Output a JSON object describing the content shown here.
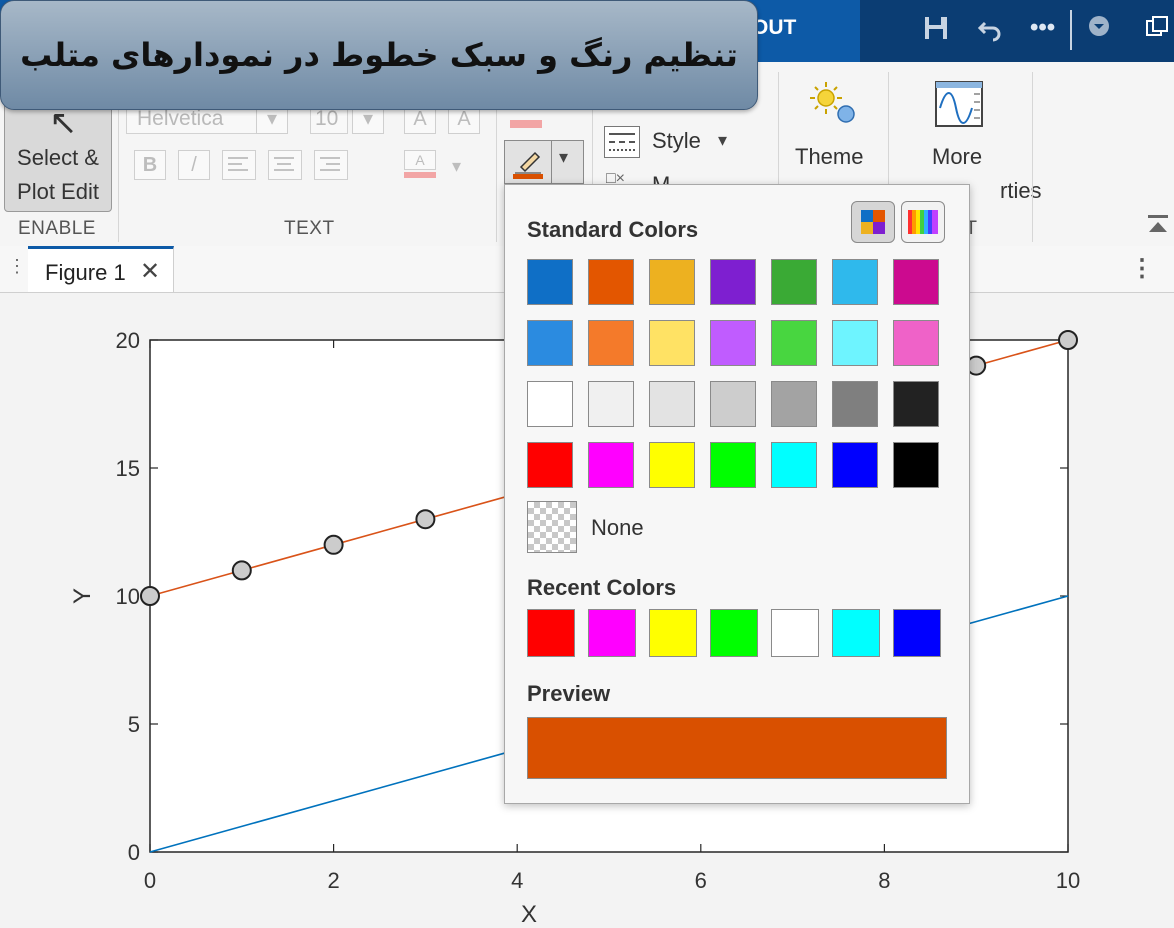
{
  "banner": {
    "title": "تنظیم رنگ و سبک خطوط در نمودارهای متلب"
  },
  "toolstrip": {
    "active_tab": "OUT",
    "icons": [
      "save-icon",
      "undo-icon",
      "more-icon",
      "dropdown-icon",
      "undock-icon"
    ]
  },
  "ribbon": {
    "select_label_1": "Select &",
    "select_label_2": "Plot Edit",
    "group_enable": "ENABLE",
    "group_text": "TEXT",
    "group_object_partial": "ECT",
    "font_name": "Helvetica",
    "font_size": "10",
    "font_grow": "A",
    "font_shrink": "A",
    "bold": "B",
    "italic": "/",
    "color_a": "A",
    "style_label": "Style",
    "marker_partial": "M",
    "theme_label": "Theme",
    "more_label_1": "More",
    "more_label_2": "rties"
  },
  "figure_tab": {
    "label": "Figure 1",
    "close": "✕"
  },
  "color_picker": {
    "standard_title": "Standard Colors",
    "standard_colors": [
      [
        "#0f6fc6",
        "#e35600",
        "#edb120",
        "#7e1fd0",
        "#3aaa35",
        "#2fb9ec",
        "#cc0a8f"
      ],
      [
        "#2b8be0",
        "#f47a2a",
        "#ffe264",
        "#c05cff",
        "#48d640",
        "#6ef4ff",
        "#ef62c8"
      ],
      [
        "#ffffff",
        "#f0f0f0",
        "#e3e3e3",
        "#cdcdcd",
        "#a3a3a3",
        "#7f7f7f",
        "#222222"
      ],
      [
        "#ff0000",
        "#ff00ff",
        "#ffff00",
        "#00ff00",
        "#00ffff",
        "#0000ff",
        "#000000"
      ]
    ],
    "none_label": "None",
    "recent_title": "Recent Colors",
    "recent_colors": [
      "#ff0000",
      "#ff00ff",
      "#ffff00",
      "#00ff00",
      "#ffffff",
      "#00ffff",
      "#0000ff"
    ],
    "preview_title": "Preview",
    "preview_color": "#d95000"
  },
  "colors": {
    "series_orange": "#d95319",
    "series_blue": "#0072bd",
    "marker_fill": "#cccccc"
  },
  "chart_data": {
    "type": "line",
    "xlabel": "X",
    "ylabel": "Y",
    "xlim": [
      0,
      10
    ],
    "ylim": [
      0,
      20
    ],
    "xticks": [
      0,
      2,
      4,
      6,
      8,
      10
    ],
    "yticks": [
      0,
      5,
      10,
      15,
      20
    ],
    "series": [
      {
        "x": [
          0,
          1,
          2,
          3,
          4,
          5,
          6,
          7,
          8,
          9,
          10
        ],
        "y": [
          10,
          11,
          12,
          13,
          14,
          15,
          16,
          17,
          18,
          19,
          20
        ],
        "color": "#d95319",
        "marker": "circle"
      },
      {
        "x": [
          0,
          10
        ],
        "y": [
          0,
          10
        ],
        "color": "#0072bd",
        "marker": "none"
      }
    ]
  }
}
